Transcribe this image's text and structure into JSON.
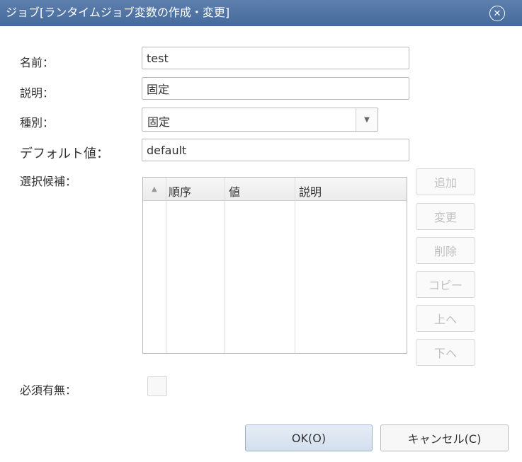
{
  "title": "ジョブ[ランタイムジョブ変数の作成・変更]",
  "close_glyph": "✕",
  "form": {
    "name": {
      "label": "名前：",
      "value": "test"
    },
    "description": {
      "label": "説明：",
      "value": "固定"
    },
    "type": {
      "label": "種別：",
      "value": "固定"
    },
    "default": {
      "label": "デフォルト値：",
      "value": "default"
    },
    "choices": {
      "label": "選択候補：",
      "columns": [
        "順序",
        "値",
        "説明"
      ],
      "rows": []
    },
    "required": {
      "label": "必須有無：",
      "checked": false
    }
  },
  "choice_buttons": {
    "add": "追加",
    "modify": "変更",
    "delete": "削除",
    "copy": "コピー",
    "up": "上へ",
    "down": "下へ"
  },
  "footer": {
    "ok": "OK(O)",
    "cancel": "キャンセル(C)"
  },
  "icons": {
    "close": "close-icon",
    "dropdown": "chevron-down-icon",
    "sort": "sort-ascending-icon"
  },
  "colors": {
    "titlebar": "#466a9b",
    "disabled_text": "#c0c0c0",
    "ok_button": "#dbe5f1"
  }
}
